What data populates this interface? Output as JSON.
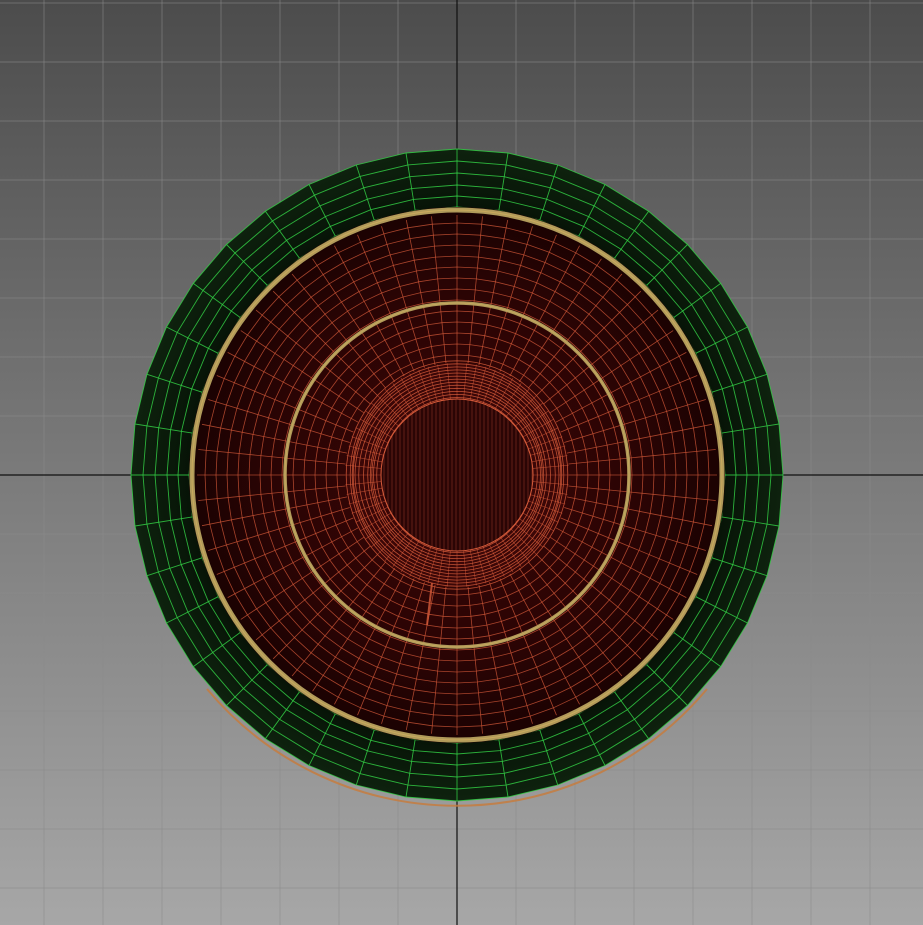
{
  "viewport": {
    "view": "top",
    "shading": "wireframe-on-shaded",
    "grid": true
  },
  "colors": {
    "background_top": "#4c4c4c",
    "background_bottom": "#a7a7a7",
    "grid_line": "#8a8a8a",
    "axis_line": "#111111",
    "outer_shell_fill": "#0a1a0a",
    "outer_shell_wire": "#33cc44",
    "inner_fill": "#2a0404",
    "inner_wire": "#d45a3a",
    "rim": "#b09a5a",
    "rim_wire": "#d4b060"
  },
  "objects": [
    {
      "name": "outer-shell",
      "selected": true
    },
    {
      "name": "inner-bowl",
      "selected": false
    },
    {
      "name": "center-ring",
      "selected": false
    }
  ]
}
